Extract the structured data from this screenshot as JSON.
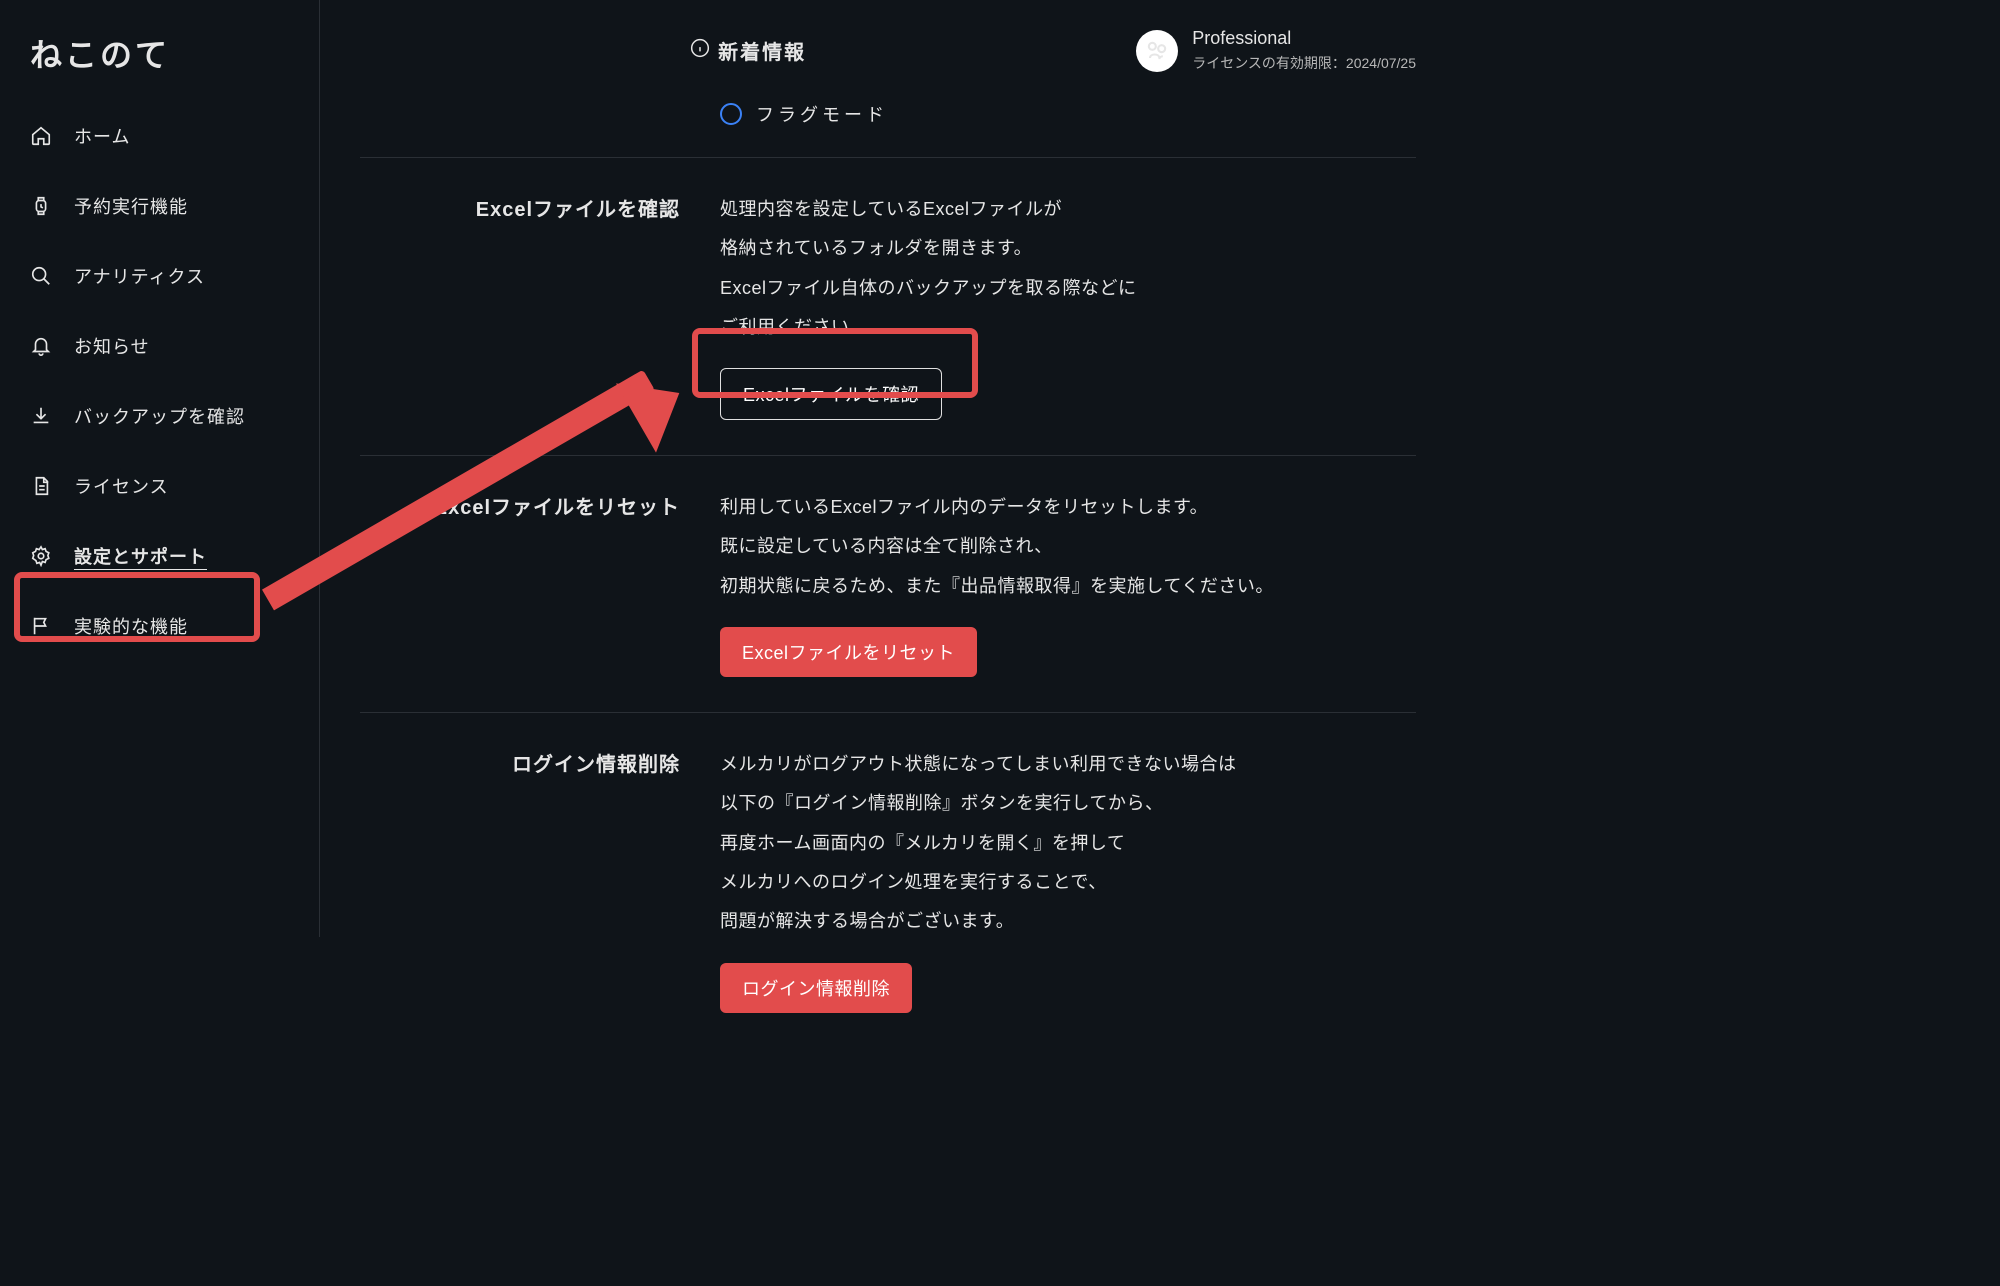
{
  "app": {
    "name": "ねこのて"
  },
  "topbar": {
    "news_label": "新着情報",
    "plan": "Professional",
    "license_expiry": "ライセンスの有効期限：2024/07/25"
  },
  "sidebar": {
    "items": [
      {
        "label": "ホーム"
      },
      {
        "label": "予約実行機能"
      },
      {
        "label": "アナリティクス"
      },
      {
        "label": "お知らせ"
      },
      {
        "label": "バックアップを確認"
      },
      {
        "label": "ライセンス"
      },
      {
        "label": "設定とサポート"
      },
      {
        "label": "実験的な機能"
      }
    ],
    "active_index": 6
  },
  "flag_mode": {
    "label": "フラグモード"
  },
  "sections": {
    "excel_confirm": {
      "title": "Excelファイルを確認",
      "desc_l1": "処理内容を設定しているExcelファイルが",
      "desc_l2": "格納されているフォルダを開きます。",
      "desc_l3": "Excelファイル自体のバックアップを取る際などに",
      "desc_l4": "ご利用ください。",
      "button": "Excelファイルを確認"
    },
    "excel_reset": {
      "title": "Excelファイルをリセット",
      "desc_l1": "利用しているExcelファイル内のデータをリセットします。",
      "desc_l2": "既に設定している内容は全て削除され、",
      "desc_l3": "初期状態に戻るため、また『出品情報取得』を実施してください。",
      "button": "Excelファイルをリセット"
    },
    "login_delete": {
      "title": "ログイン情報削除",
      "desc_l1": "メルカリがログアウト状態になってしまい利用できない場合は",
      "desc_l2": "以下の『ログイン情報削除』ボタンを実行してから、",
      "desc_l3": "再度ホーム画面内の『メルカリを開く』を押して",
      "desc_l4": "メルカリへのログイン処理を実行することで、",
      "desc_l5": "問題が解決する場合がございます。",
      "button": "ログイン情報削除"
    }
  }
}
